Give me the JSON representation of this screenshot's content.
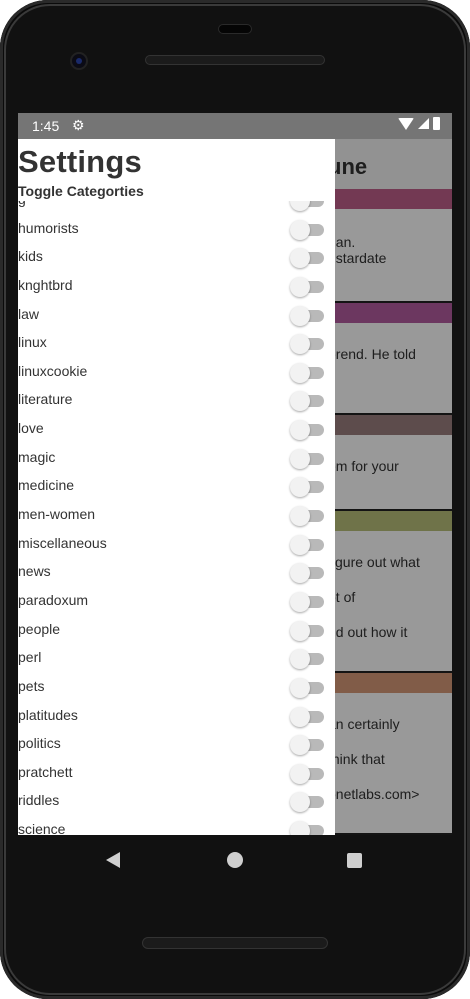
{
  "status": {
    "time": "1:45"
  },
  "background": {
    "title": "une",
    "cards": [
      {
        "header_color": "#c0608a",
        "lines": [
          "nan.",
          ", stardate"
        ]
      },
      {
        "header_color": "#b45ca0",
        "lines": [
          "erend.  He told"
        ]
      },
      {
        "header_color": "#9b7f7f",
        "lines": [
          "em for your"
        ]
      },
      {
        "header_color": "#b9c07a",
        "lines": [
          "figure out what",
          "ot of",
          "nd out how it"
        ]
      },
      {
        "header_color": "#d89a79",
        "lines": [
          "an certainly",
          " think that",
          "onetlabs.com>"
        ]
      }
    ]
  },
  "drawer": {
    "title": "Settings",
    "subtitle": "Toggle Categorties",
    "categories": [
      "g",
      "humorists",
      "kids",
      "knghtbrd",
      "law",
      "linux",
      "linuxcookie",
      "literature",
      "love",
      "magic",
      "medicine",
      "men-women",
      "miscellaneous",
      "news",
      "paradoxum",
      "people",
      "perl",
      "pets",
      "platitudes",
      "politics",
      "pratchett",
      "riddles",
      "science"
    ]
  },
  "colors": {
    "status_bar": "#757575",
    "toggle_track_off": "#b9b9b9",
    "toggle_knob_off": "#f2f2f2"
  },
  "icons": {
    "status_gear": "gear-icon",
    "nav_back": "back-icon",
    "nav_home": "home-icon",
    "nav_recents": "recents-icon"
  }
}
